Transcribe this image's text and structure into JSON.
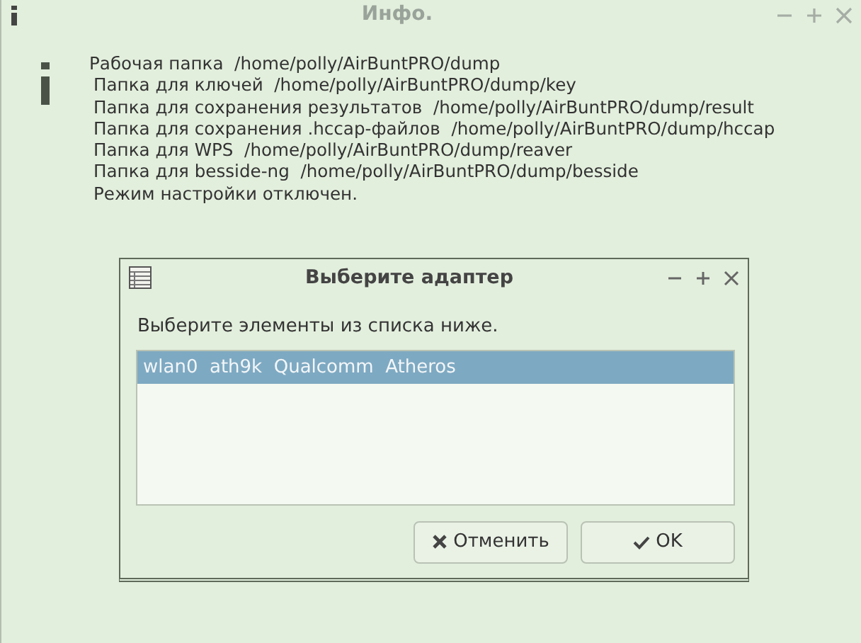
{
  "window": {
    "title": "Инфо."
  },
  "message_lines": [
    "Рабочая папка  /home/polly/AirBuntPRO/dump",
    "Папка для ключей  /home/polly/AirBuntPRO/dump/key",
    "Папка для сохранения результатов  /home/polly/AirBuntPRO/dump/result",
    "Папка для сохранения .hccap-файлов  /home/polly/AirBuntPRO/dump/hccap",
    "Папка для WPS  /home/polly/AirBuntPRO/dump/reaver",
    "Папка для besside-ng  /home/polly/AirBuntPRO/dump/besside",
    "Режим настройки отключен."
  ],
  "dialog": {
    "title": "Выберите адаптер",
    "prompt": "Выберите элементы из списка ниже.",
    "items": [
      {
        "label": "wlan0  ath9k  Qualcomm  Atheros",
        "selected": true
      }
    ],
    "buttons": [
      {
        "kind": "cancel",
        "label": "Отменить"
      },
      {
        "kind": "ok",
        "label": "OK"
      }
    ]
  }
}
